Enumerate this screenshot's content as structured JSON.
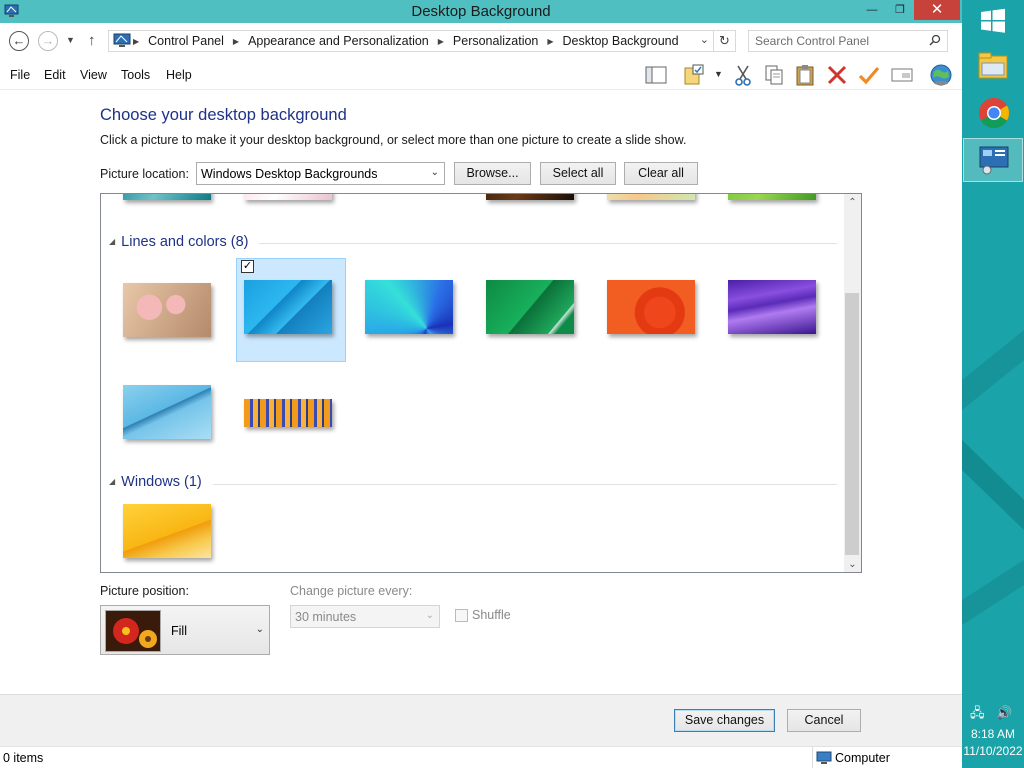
{
  "window": {
    "title": "Desktop Background",
    "controls": {
      "minimize": "—",
      "maximize": "❐",
      "close": "✕"
    }
  },
  "address": {
    "crumbs": [
      "Control Panel",
      "Appearance and Personalization",
      "Personalization",
      "Desktop Background"
    ],
    "search_placeholder": "Search Control Panel"
  },
  "menu": [
    "File",
    "Edit",
    "View",
    "Tools",
    "Help"
  ],
  "toolbar_icons": [
    "pane-icon",
    "properties-icon",
    "cut-icon",
    "copy-icon",
    "paste-icon",
    "delete-icon",
    "checkmark-icon",
    "panel-icon",
    "globe-icon"
  ],
  "content": {
    "heading": "Choose your desktop background",
    "subtext": "Click a picture to make it your desktop background, or select more than one picture to create a slide show.",
    "picture_location_label": "Picture location:",
    "picture_location_value": "Windows Desktop Backgrounds",
    "browse_label": "Browse...",
    "select_all_label": "Select all",
    "clear_all_label": "Clear all"
  },
  "gallery": {
    "groups": [
      {
        "name": "Lines and colors (8)"
      },
      {
        "name": "Windows (1)"
      }
    ]
  },
  "bottom": {
    "position_label": "Picture position:",
    "position_value": "Fill",
    "change_label": "Change picture every:",
    "change_value": "30 minutes",
    "shuffle_label": "Shuffle",
    "save_label": "Save changes",
    "cancel_label": "Cancel"
  },
  "status": {
    "left": "0 items",
    "right": "Computer"
  },
  "taskbar": {
    "time": "8:18 AM",
    "date": "11/10/2022"
  },
  "colors": {
    "titlebar": "#4fbfc2",
    "taskbar": "#1aa3a8",
    "heading": "#1e3287",
    "close_button": "#c7423a"
  }
}
